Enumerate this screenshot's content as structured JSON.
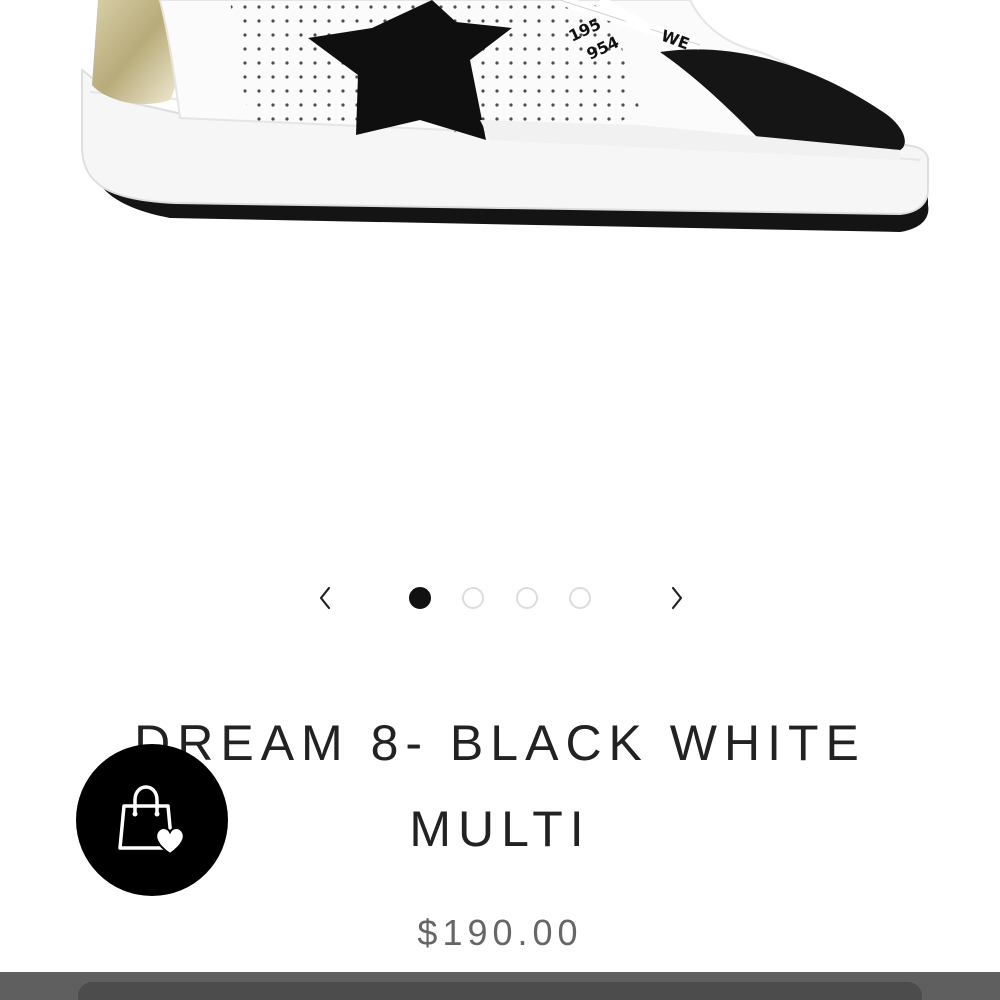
{
  "product": {
    "title_line1": "DREAM 8- BLACK WHITE",
    "title_line2": "MULTI",
    "price": "$190.00"
  },
  "carousel": {
    "total_images": 4,
    "active_index": 0
  },
  "icons": {
    "prev": "chevron-left-icon",
    "next": "chevron-right-icon",
    "wishlist": "shopping-bag-heart-icon"
  },
  "colors": {
    "text": "#222222",
    "price": "#666666",
    "active_dot": "#111111",
    "inactive_dot_border": "#dcdcdc",
    "wishlist_bg": "#000000",
    "bottom_bar": "#5f5f5f"
  }
}
